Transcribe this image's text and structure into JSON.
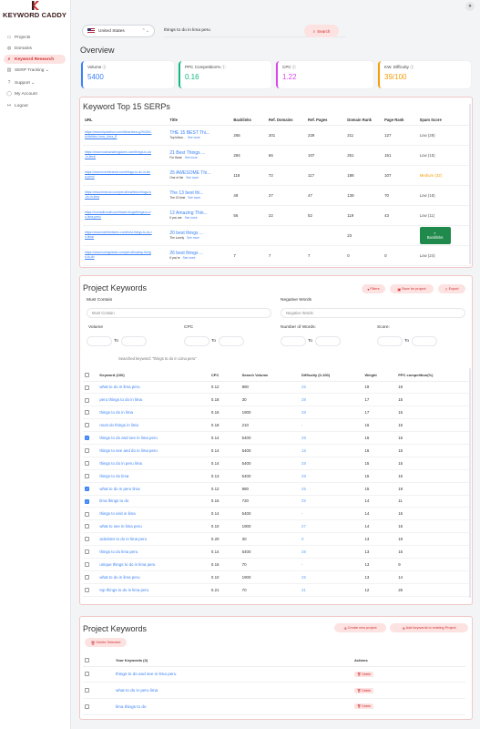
{
  "brand": {
    "name": "KEYWORD CADDY"
  },
  "nav": [
    {
      "icon": "folder-icon",
      "label": "Projects",
      "active": false
    },
    {
      "icon": "globe-icon",
      "label": "Domains",
      "active": false
    },
    {
      "icon": "search-icon",
      "label": "Keyword Research",
      "active": true
    },
    {
      "icon": "chart-icon",
      "label": "SERP Tracking ⌄",
      "active": false
    },
    {
      "icon": "support-icon",
      "label": "Support ⌄",
      "active": false
    },
    {
      "icon": "user-icon",
      "label": "My Account",
      "active": false
    },
    {
      "icon": "logout-icon",
      "label": "Logout",
      "active": false
    }
  ],
  "search": {
    "country": "United States",
    "keyword": "things to do in lima peru",
    "button": "Search"
  },
  "overview": {
    "title": "Overview",
    "cards": [
      {
        "label": "Volume",
        "value": "5400",
        "color": "#3b82f6"
      },
      {
        "label": "PPC Competition%",
        "value": "0.16",
        "color": "#10b981"
      },
      {
        "label": "CPC",
        "value": "1.22",
        "color": "#d946ef"
      },
      {
        "label": "KW. Difficulty",
        "value": "39/100",
        "color": "#f59e0b"
      }
    ]
  },
  "serp": {
    "title": "Keyword Top 15 SERPs",
    "columns": [
      "URL",
      "Title",
      "Backlinks",
      "Ref. Domains",
      "Ref. Pages",
      "Domain Rank",
      "Page Rank",
      "Spam Score"
    ],
    "rows": [
      {
        "url": "https://www.tripadvisor.com/Attractions-g294316-Activities-Lima_Lima_R",
        "title": "THE 15 BEST Thi...",
        "sub": "Top foliow...",
        "more": "See more",
        "backlinks": "265",
        "refdomains": "201",
        "refpages": "229",
        "domainrank": "211",
        "pagerank": "127",
        "spam": "Low (28)",
        "spamcolor": "#555"
      },
      {
        "url": "https://www.roadsandkingdoms.com/things-to-do-in-lima/",
        "title": "21 Best Things ...",
        "sub": "For those",
        "more": "See more",
        "backlinks": "284",
        "refdomains": "66",
        "refpages": "107",
        "domainrank": "251",
        "pagerank": "151",
        "spam": "Low (15)",
        "spamcolor": "#555"
      },
      {
        "url": "https://www.everintransit.com/things-to-do-in-lima-peru/",
        "title": "25 AWESOME Thi...",
        "sub": "One of the",
        "more": "See more",
        "backlinks": "118",
        "refdomains": "72",
        "refpages": "117",
        "domainrank": "188",
        "pagerank": "107",
        "spam": "Medium (32)",
        "spamcolor": "#f59e0b"
      },
      {
        "url": "https://www.timeout.com/peru/lima/best-things-to-do-in-lima",
        "title": "The 13 best thi...",
        "sub": "The 13 best",
        "more": "See more",
        "backlinks": "49",
        "refdomains": "27",
        "refpages": "47",
        "domainrank": "139",
        "pagerank": "70",
        "spam": "Low (18)",
        "spamcolor": "#555"
      },
      {
        "url": "https://nomadicmatt.com/travel-blogs/things-to-do-lima-peru/",
        "title": "12 Amazing Thin...",
        "sub": "If you are",
        "more": "See more",
        "backlinks": "56",
        "refdomains": "22",
        "refpages": "52",
        "domainrank": "119",
        "pagerank": "43",
        "spam": "Low (11)",
        "spamcolor": "#555"
      },
      {
        "url": "https://www.earthtrekkers.com/best-things-to-do-in-lima/",
        "title": "20 best things ...",
        "sub": "The Lonely",
        "more": "See more",
        "backlinks": "",
        "refdomains": "",
        "refpages": "",
        "domainrank": "23",
        "pagerank": "",
        "spam": "",
        "spamcolor": "#555",
        "action": "Backlinks"
      },
      {
        "url": "https://www.lonelyplanet.com/peru/lima/top-things-to-do",
        "title": "26 best things ...",
        "sub": "If you're",
        "more": "See more",
        "backlinks": "7",
        "refdomains": "7",
        "refpages": "7",
        "domainrank": "0",
        "pagerank": "0",
        "spam": "Low (24)",
        "spamcolor": "#555"
      }
    ]
  },
  "project": {
    "title": "Project Keywords",
    "filters_btn": "Filters",
    "save_btn": "Save for project",
    "export_btn": "Export",
    "must_contain_label": "Must Contain",
    "must_contain_ph": "Must Contain",
    "negative_label": "Negative Words",
    "negative_ph": "Negative Words",
    "volume_label": "Volume",
    "cpc_label": "CPC",
    "words_label": "Number of Words:",
    "score_label": "Score:",
    "to": "To",
    "searched": "Searched keyword: \"things to do in Lima peru\"",
    "columns": [
      "Keyword (100)",
      "CPC",
      "Search Volume",
      "Difficulty (0-100)",
      "Weight",
      "PPC competition(%)"
    ],
    "rows": [
      {
        "checked": false,
        "kw": "what to do in lima peru",
        "cpc": "0.12",
        "vol": "880",
        "diff": "25",
        "w": "19",
        "ppc": "19"
      },
      {
        "checked": false,
        "kw": "peru things to do in lima",
        "cpc": "0.18",
        "vol": "30",
        "diff": "28",
        "w": "17",
        "ppc": "15"
      },
      {
        "checked": false,
        "kw": "things to do in lima",
        "cpc": "0.16",
        "vol": "1900",
        "diff": "28",
        "w": "17",
        "ppc": "15"
      },
      {
        "checked": false,
        "kw": "must do things in lima",
        "cpc": "0.18",
        "vol": "210",
        "diff": "-",
        "w": "16",
        "ppc": "15"
      },
      {
        "checked": true,
        "kw": "things to do and see in lima peru",
        "cpc": "0.14",
        "vol": "5400",
        "diff": "28",
        "w": "16",
        "ppc": "15"
      },
      {
        "checked": false,
        "kw": "things to see and do in lima peru",
        "cpc": "0.14",
        "vol": "5400",
        "diff": "15",
        "w": "16",
        "ppc": "15"
      },
      {
        "checked": false,
        "kw": "things to do in peru lima",
        "cpc": "0.14",
        "vol": "5400",
        "diff": "28",
        "w": "15",
        "ppc": "15"
      },
      {
        "checked": false,
        "kw": "things to do lima",
        "cpc": "0.13",
        "vol": "5400",
        "diff": "28",
        "w": "15",
        "ppc": "15"
      },
      {
        "checked": true,
        "kw": "what to do in peru lima",
        "cpc": "0.12",
        "vol": "880",
        "diff": "25",
        "w": "15",
        "ppc": "19"
      },
      {
        "checked": true,
        "kw": "lima things to do",
        "cpc": "0.16",
        "vol": "720",
        "diff": "25",
        "w": "14",
        "ppc": "11"
      },
      {
        "checked": false,
        "kw": "things to visit in lima",
        "cpc": "0.14",
        "vol": "5400",
        "diff": "-",
        "w": "14",
        "ppc": "15"
      },
      {
        "checked": false,
        "kw": "what to see in lima peru",
        "cpc": "0.10",
        "vol": "1900",
        "diff": "27",
        "w": "14",
        "ppc": "15"
      },
      {
        "checked": false,
        "kw": "activities to do in lima peru",
        "cpc": "0.20",
        "vol": "30",
        "diff": "0",
        "w": "13",
        "ppc": "19"
      },
      {
        "checked": false,
        "kw": "things to do lima peru",
        "cpc": "0.14",
        "vol": "5400",
        "diff": "28",
        "w": "13",
        "ppc": "15"
      },
      {
        "checked": false,
        "kw": "unique things to do in lima peru",
        "cpc": "0.16",
        "vol": "70",
        "diff": "-",
        "w": "13",
        "ppc": "9"
      },
      {
        "checked": false,
        "kw": "what to do in lima peru",
        "cpc": "0.10",
        "vol": "1900",
        "diff": "25",
        "w": "13",
        "ppc": "14"
      },
      {
        "checked": false,
        "kw": "top things to do in lima peru",
        "cpc": "0.21",
        "vol": "70",
        "diff": "31",
        "w": "12",
        "ppc": "26"
      }
    ]
  },
  "project2": {
    "title": "Project Keywords",
    "create_btn": "Create new project",
    "add_btn": "Add keywords to existing Project",
    "delete_btn": "Delete Selected",
    "col_kw": "Your Keywords (3)",
    "col_actions": "Actions",
    "delete_label": "Delete",
    "rows": [
      "things to do and see in lima peru",
      "what to do in peru lima",
      "lima things to do"
    ]
  }
}
